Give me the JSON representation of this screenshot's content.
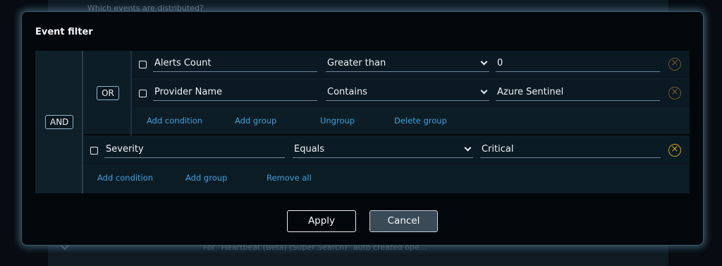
{
  "background": {
    "header_text": "Which events are distributed?",
    "footer_text": "For \"Heartbeat (Beta) (Super Search)\" auto created ope..."
  },
  "dialog": {
    "title": "Event filter",
    "root_operator": "AND",
    "group": {
      "operator": "OR",
      "conditions": [
        {
          "field": "Alerts Count",
          "operator": "Greater than",
          "value": "0"
        },
        {
          "field": "Provider Name",
          "operator": "Contains",
          "value": "Azure Sentinel"
        }
      ],
      "actions": {
        "add_condition": "Add condition",
        "add_group": "Add group",
        "ungroup": "Ungroup",
        "delete_group": "Delete group"
      }
    },
    "condition": {
      "field": "Severity",
      "operator": "Equals",
      "value": "Critical"
    },
    "root_actions": {
      "add_condition": "Add condition",
      "add_group": "Add group",
      "remove_all": "Remove all"
    },
    "buttons": {
      "apply": "Apply",
      "cancel": "Cancel"
    }
  },
  "icons": {
    "remove": "remove-circle-icon",
    "dropdown": "chevron-down-icon",
    "checkbox": "checkbox-icon"
  },
  "colors": {
    "accent_link": "#3fa0dd",
    "remove_active": "#d99c1a",
    "dialog_glow": "#78aac8"
  }
}
